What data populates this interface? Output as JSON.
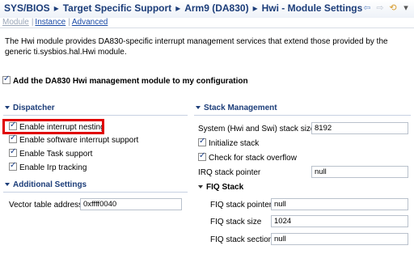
{
  "breadcrumb": {
    "items": [
      "SYS/BIOS",
      "Target Specific Support",
      "Arm9 (DA830)",
      "Hwi - Module Settings"
    ]
  },
  "nav_icons": [
    "back-arrow-icon",
    "forward-arrow-icon",
    "sync-icon",
    "menu-icon"
  ],
  "tabs": [
    {
      "label": "Module",
      "state": "inactive"
    },
    {
      "label": "Instance",
      "state": "link"
    },
    {
      "label": "Advanced",
      "state": "link"
    }
  ],
  "description": "The Hwi module provides DA830-specific interrupt management services that extend those provided by the generic ti.sysbios.hal.Hwi module.",
  "add_module": {
    "label": "Add the DA830 Hwi management module to my configuration",
    "checked": true
  },
  "dispatcher": {
    "title": "Dispatcher",
    "options": [
      {
        "label": "Enable interrupt nesting",
        "checked": true
      },
      {
        "label": "Enable software interrupt support",
        "checked": true
      },
      {
        "label": "Enable Task support",
        "checked": true
      },
      {
        "label": "Enable Irp tracking",
        "checked": true
      }
    ]
  },
  "additional": {
    "title": "Additional Settings",
    "vector_label": "Vector table address",
    "vector_value": "0xffff0040"
  },
  "stack": {
    "title": "Stack Management",
    "stack_size_label": "System (Hwi and Swi) stack size",
    "stack_size_value": "8192",
    "initialize_label": "Initialize stack",
    "overflow_label": "Check for stack overflow",
    "irq_label": "IRQ stack pointer",
    "irq_value": "null"
  },
  "fiq": {
    "title": "FIQ Stack",
    "pointer_label": "FIQ stack pointer",
    "pointer_value": "null",
    "size_label": "FIQ stack size",
    "size_value": "1024",
    "section_label": "FIQ stack section",
    "section_value": "null"
  },
  "colors": {
    "highlight": "#e00000",
    "accent": "#1c3d79",
    "link": "#1a4aa6"
  }
}
